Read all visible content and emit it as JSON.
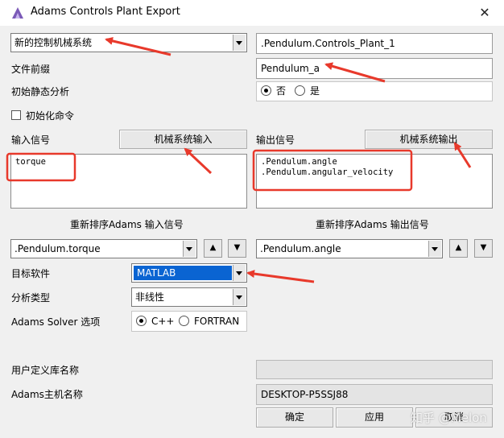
{
  "window": {
    "title": "Adams Controls Plant Export",
    "close_glyph": "✕"
  },
  "plant_type": {
    "selected": "新的控制机械系统"
  },
  "plant_name": {
    "value": ".Pendulum.Controls_Plant_1"
  },
  "file_prefix": {
    "label": "文件前缀",
    "value": "Pendulum_a"
  },
  "initial_static": {
    "label": "初始静态分析",
    "options": [
      "否",
      "是"
    ],
    "selected": "否"
  },
  "init_command": {
    "label": "初始化命令"
  },
  "input_signals": {
    "label": "输入信号",
    "button": "机械系统输入",
    "items": [
      "torque"
    ],
    "reorder_label": "重新排序Adams 输入信号",
    "reorder_selected": ".Pendulum.torque"
  },
  "output_signals": {
    "label": "输出信号",
    "button": "机械系统输出",
    "items": [
      ".Pendulum.angle",
      ".Pendulum.angular_velocity"
    ],
    "reorder_label": "重新排序Adams 输出信号",
    "reorder_selected": ".Pendulum.angle"
  },
  "move_up_glyph": "▲",
  "move_down_glyph": "▼",
  "target_software": {
    "label": "目标软件",
    "selected": "MATLAB"
  },
  "analysis_type": {
    "label": "分析类型",
    "selected": "非线性"
  },
  "solver": {
    "label": "Adams Solver 选项",
    "options": [
      "C++",
      "FORTRAN"
    ],
    "selected": "C++"
  },
  "user_library": {
    "label": "用户定义库名称",
    "value": ""
  },
  "host": {
    "label": "Adams主机名称",
    "value": "DESKTOP-P5SSJ88"
  },
  "buttons": {
    "ok": "确定",
    "apply": "应用",
    "cancel": "取消"
  },
  "watermark": "知乎 @Melon",
  "colors": {
    "selection": "#0a64d2",
    "annotation": "#e8392b"
  }
}
